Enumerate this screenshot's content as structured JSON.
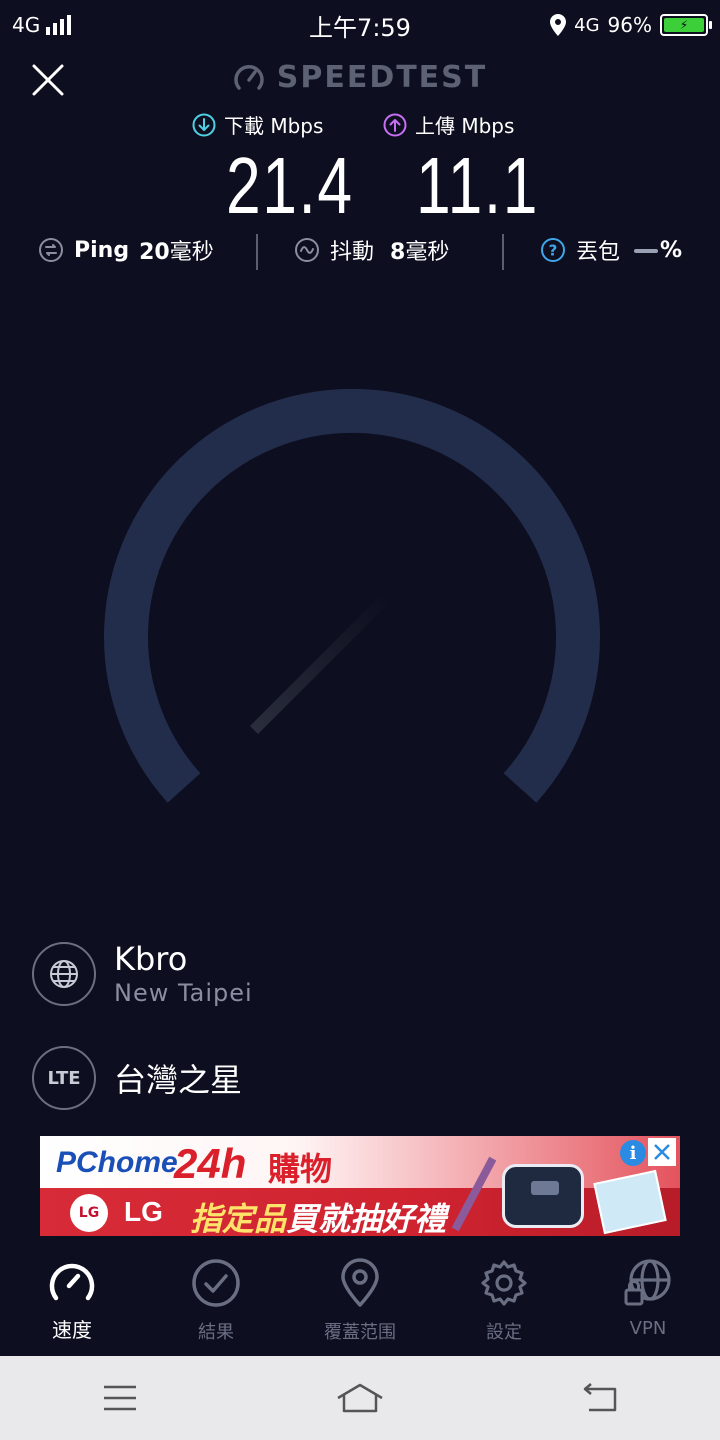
{
  "status_bar": {
    "network_type_left": "4G",
    "time": "上午7:59",
    "network_type_right": "4G",
    "battery_percent": "96%"
  },
  "header": {
    "brand": "SPEEDTEST"
  },
  "speed": {
    "download_label": "下載 Mbps",
    "upload_label": "上傳 Mbps",
    "download_value": "21.4",
    "upload_value": "11.1"
  },
  "metrics": {
    "ping_label": "Ping",
    "ping_value": "20",
    "ping_unit": "毫秒",
    "jitter_label": "抖動",
    "jitter_value": "8",
    "jitter_unit": "毫秒",
    "loss_label": "丟包",
    "loss_unit": "%"
  },
  "server": {
    "isp_name": "Kbro",
    "isp_location": "New Taipei",
    "carrier_badge": "LTE",
    "carrier_name": "台灣之星"
  },
  "ad": {
    "pchome": "PChome",
    "hours": "24h",
    "shopping": "購物",
    "lg_badge": "LG",
    "lg_text": "LG",
    "slogan_part1": "指定品",
    "slogan_part2": "買就抽好禮",
    "info_glyph": "i"
  },
  "tabs": [
    {
      "label": "速度",
      "icon": "speedometer-icon",
      "active": true
    },
    {
      "label": "結果",
      "icon": "check-circle-icon",
      "active": false
    },
    {
      "label": "覆蓋范围",
      "icon": "map-pin-icon",
      "active": false
    },
    {
      "label": "設定",
      "icon": "gear-icon",
      "active": false
    },
    {
      "label": "VPN",
      "icon": "vpn-globe-lock-icon",
      "active": false
    }
  ],
  "colors": {
    "background": "#0d0e1f",
    "gauge_track": "#222d4b",
    "download_accent": "#4fd1e3",
    "upload_accent": "#c66ff2",
    "loss_accent": "#3fa7e8",
    "muted_text": "#6a6e82"
  }
}
